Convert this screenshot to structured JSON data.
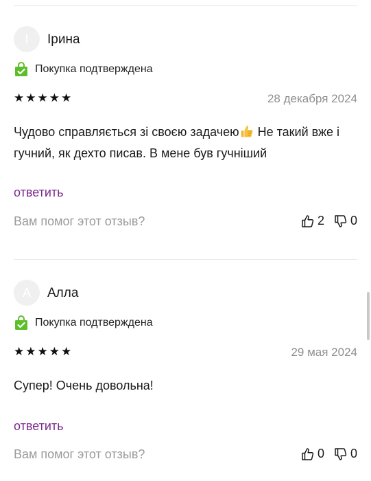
{
  "reviews": [
    {
      "avatar_letter": "I",
      "author": "Ірина",
      "verified_label": "Покупка подтверждена",
      "stars": "★★★★★",
      "date": "28 декабря 2024",
      "text_part1": "Чудово справляється зі своєю задачею",
      "text_part2": " Не такий вже і гучний, як дехто писав. В мене був гучніший",
      "reply_label": "ответить",
      "helpful_question": "Вам помог этот отзыв?",
      "likes": "2",
      "dislikes": "0"
    },
    {
      "avatar_letter": "А",
      "author": "Алла",
      "verified_label": "Покупка подтверждена",
      "stars": "★★★★★",
      "date": "29 мая 2024",
      "text": "Супер! Очень довольна!",
      "reply_label": "ответить",
      "helpful_question": "Вам помог этот отзыв?",
      "likes": "0",
      "dislikes": "0"
    }
  ],
  "colors": {
    "verified_green": "#5cbf2a",
    "reply_link": "#7b2a8a",
    "muted_text": "#9a9a9a",
    "divider": "#e6e6e6"
  },
  "icons": [
    "shopping-bag-check-icon",
    "thumbs-up-emoji-icon",
    "thumb-up-icon",
    "thumb-down-icon"
  ]
}
